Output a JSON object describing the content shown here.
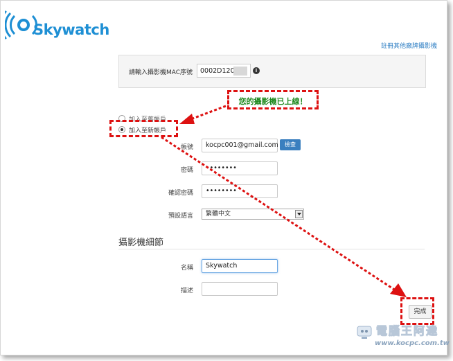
{
  "brand": {
    "name": "Skywatch",
    "color": "#1e8fd4"
  },
  "header": {
    "register_other_link": "註冊其他廠牌攝影機"
  },
  "mac": {
    "label": "請輸入攝影機MAC序號",
    "value": "0002D120"
  },
  "callout": {
    "text": "您的攝影機已上線！"
  },
  "account_options": [
    {
      "label": "加入至舊帳戶",
      "selected": false
    },
    {
      "label": "加入至新帳戶",
      "selected": true
    }
  ],
  "form": {
    "account_label": "帳號",
    "account_value": "kocpc001@gmail.com",
    "check_button": "檢查",
    "password_label": "密碼",
    "password_value": "••••••••",
    "confirm_label": "確認密碼",
    "confirm_value": "••••••••",
    "language_label": "預設語言",
    "language_value": "繁體中文"
  },
  "camera_section": {
    "title": "攝影機細節",
    "name_label": "名稱",
    "name_value": "Skywatch",
    "desc_label": "描述",
    "desc_value": ""
  },
  "actions": {
    "done_button": "完成"
  },
  "watermark": {
    "title": "電腦王阿達",
    "url": "www.kocpc.com.tw"
  },
  "colors": {
    "annotation_red": "#dd1111",
    "callout_green": "#1f8a1f",
    "link_blue": "#2f7fc4"
  }
}
